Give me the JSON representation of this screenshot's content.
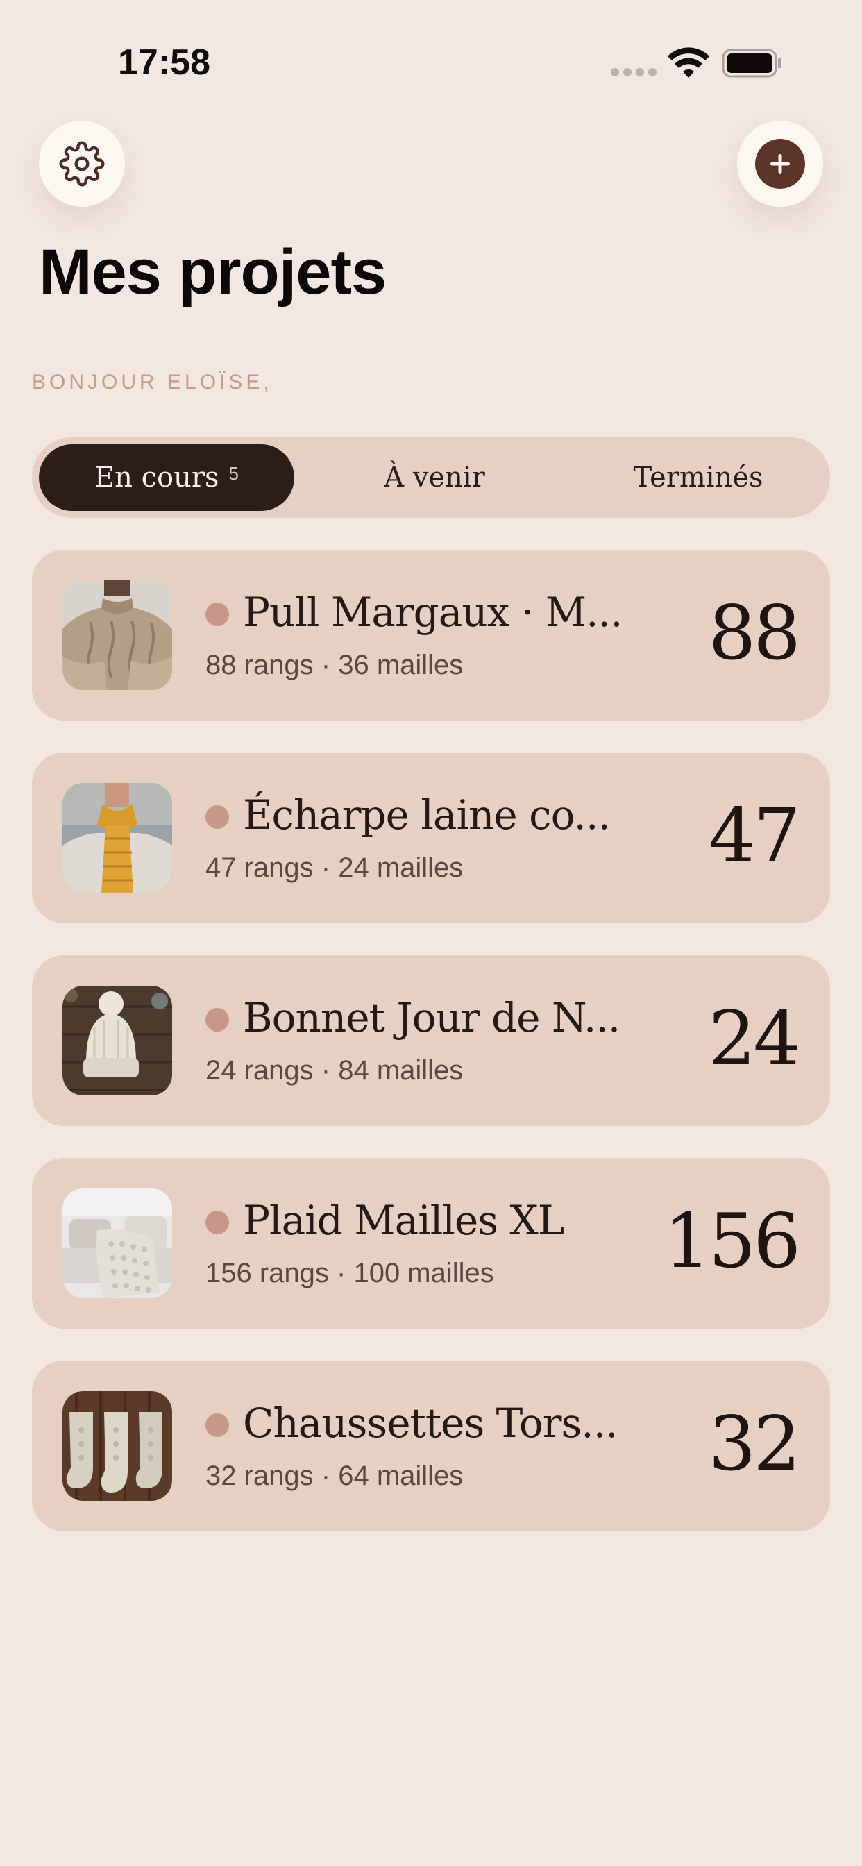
{
  "status_bar": {
    "time": "17:58"
  },
  "header": {
    "title": "Mes projets",
    "greeting": "BONJOUR ELOÏSE,",
    "settings_icon": "gear-icon",
    "add_icon": "plus-icon"
  },
  "tabs": [
    {
      "label": "En cours",
      "count": "5",
      "active": true
    },
    {
      "label": "À venir",
      "active": false
    },
    {
      "label": "Terminés",
      "active": false
    }
  ],
  "projects": [
    {
      "name": "Pull Margaux · M...",
      "meta": "88 rangs · 36 mailles",
      "count": "88",
      "image": "sweater"
    },
    {
      "name": "Écharpe laine co...",
      "meta": "47 rangs · 24 mailles",
      "count": "47",
      "image": "scarf"
    },
    {
      "name": "Bonnet Jour de N...",
      "meta": "24 rangs · 84 mailles",
      "count": "24",
      "image": "beanie"
    },
    {
      "name": "Plaid Mailles XL",
      "meta": "156 rangs · 100 mailles",
      "count": "156",
      "image": "blanket"
    },
    {
      "name": "Chaussettes Tors...",
      "meta": "32 rangs · 64 mailles",
      "count": "32",
      "image": "socks"
    }
  ],
  "colors": {
    "background": "#f2e7e1",
    "card": "#e6cfc3",
    "accent_dark": "#2c1d19",
    "status_dot": "#c79888",
    "greeting": "#c99a86"
  }
}
